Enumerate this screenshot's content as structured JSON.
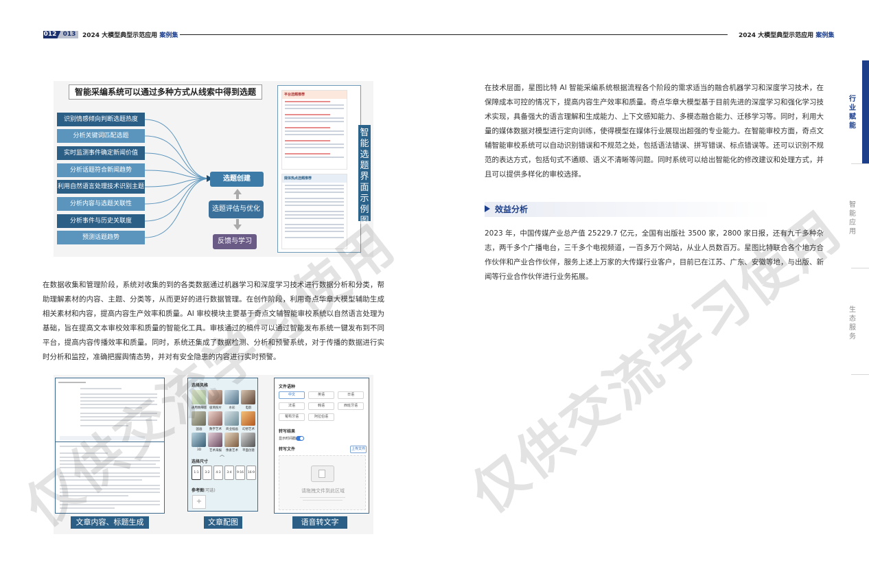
{
  "header": {
    "page_left": "012",
    "page_right": "013",
    "left_title_main": "2024 大模型典型示范应用",
    "left_title_accent": "案例集",
    "right_title_main": "2024 大模型典型示范应用",
    "right_title_accent": "案例集"
  },
  "side_tabs": {
    "tab1": "行业赋能",
    "tab2": "智能应用",
    "tab3": "生态服务"
  },
  "diagram": {
    "title": "智能采编系统可以通过多种方式从线索中得到选题",
    "left_items": [
      "识别情感倾向判断选题热度",
      "分析关键词匹配选题",
      "实时监测事件确定新闻价值",
      "分析话题符合新闻趋势",
      "利用自然语言处理技术识别主题",
      "分析内容与选题关联性",
      "分析事件与历史关联度",
      "预测话题趋势"
    ],
    "node_create": "选题创建",
    "node_eval": "选题评估与优化",
    "node_feedback": "反馈与学习",
    "vertical_label": "智能选题界面示例图",
    "panel1_header": "平台选题推荐",
    "panel2_header": "媒体热点选题推荐"
  },
  "left_paragraph": "在数据收集和管理阶段，系统对收集的到的各类数据通过机器学习和深度学习技术进行数据分析和分类，帮助理解素材的内容、主题、分类等，从而更好的进行数据管理。在创作阶段，利用奇点华章大模型辅助生成相关素材和内容，提高内容生产效率和质量。AI 审校模块主要基于奇点文辅智能审校系统以自然语言处理为基础，旨在提高文本审校效率和质量的智能化工具。审核通过的稿件可以通过智能发布系统一键发布到不同平台，提高内容传播效率和质量。同时，系统还集成了数据检测、分析和预警系统，对于传播的数据进行实时分析和监控，准确把握舆情态势，并对有安全隐患的内容进行实时预警。",
  "right_paragraph1": "在技术层面，星图比特 AI 智能采编系统根据流程各个阶段的需求适当的融合机器学习和深度学习技术，在保障成本可控的情况下，提高内容生产效率和质量。奇点华章大模型基于目前先进的深度学习和强化学习技术实现，具备强大的语言理解和生成能力、上下文感知能力、多模态融合能力、迁移学习等。同时，利用大量的媒体数据对模型进行定向训练，使得模型在媒体行业展现出超强的专业能力。在智能审校方面，奇点文辅智能审校系统可以自动识别错误和不规范之处，包括语法错误、拼写错误、标点错误等。还可以识别不规范的表达方式，包括句式不通顺、语义不清晰等问题。同时系统可以给出智能化的修改建议和处理方式，并且可以提供多样化的审校选择。",
  "section_title": "效益分析",
  "right_paragraph2": "2023 年，中国传媒产业总产值 25229.7 亿元，全国有出版社 3500 家，2800 家日报，还有九千多种杂志，两千多个广播电台，三千多个电视频道，一百多万个网站，从业人员数百万。星图比特联合各个地方合作伙伴和产业合作伙伴，服务上述上万家的大传媒行业客户，目前已在江苏、广东、安徽等地，与出版、新闻等行业合作伙伴进行业务拓展。",
  "screens": {
    "caption1": "文章内容、标题生成",
    "caption2": "文章配图",
    "caption3": "语音转文字",
    "s2_style_label": "选择风格",
    "s2_styles": [
      "通用精细版",
      "极简照片",
      "水彩",
      "电影",
      "国画",
      "数字艺术",
      "商业插画",
      "幻想艺术",
      "3D",
      "艺术海报",
      "像素艺术",
      "平面创意"
    ],
    "s2_size_label": "选择尺寸",
    "s2_ratios": [
      "1:1",
      "3:2",
      "4:3",
      "3:4",
      "9:16",
      "16:9"
    ],
    "s2_ref_label": "参考图",
    "s2_ref_hint": "(可选)",
    "s3_lang_label": "文件语种",
    "s3_langs": [
      "中文",
      "英语",
      "日语",
      "法语",
      "韩语",
      "西班牙语",
      "葡萄牙语",
      "阿拉伯语"
    ],
    "s3_result_label": "转写结果",
    "s3_toggle_label": "显示时间戳",
    "s3_file_label": "转写文件",
    "s3_upload_btn": "上传文件",
    "s3_drop_text": "请拖拽文件到此区域"
  },
  "watermark": "仅供交流学习使用",
  "colors": {
    "brand_navy": "#1d3f8a",
    "diagram_blue": "#2c5f86",
    "diagram_light_blue": "#5b95bd",
    "feedback_purple": "#6a5a86"
  }
}
